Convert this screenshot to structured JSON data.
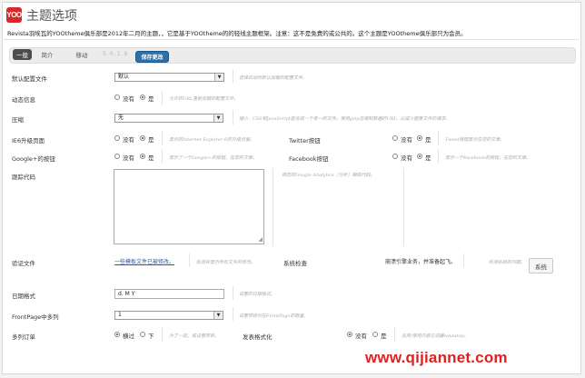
{
  "header": {
    "logo_text": "YOO",
    "title": "主题选项",
    "intro": "Revista羽埃瓦的YOOtheme俱乐部是2012年二月的主题，，它是基于YOOtheme的的轻线主题框架。注意：这不是免费的或公共的。这个主题是YOOtheme俱乐部只为会员。"
  },
  "tabs": [
    {
      "label": "一般",
      "active": true
    },
    {
      "label": "简介",
      "active": false
    },
    {
      "label": "移动",
      "active": false
    }
  ],
  "version": "5.0.1.8",
  "save_label": "保存更改",
  "fields": {
    "default_config": {
      "label": "默认配置文件",
      "value": "默认",
      "desc": "选择启动时默认加载的配置文件。"
    },
    "dynamic": {
      "label": "动态信息",
      "opt_no": "没有",
      "opt_yes": "是",
      "selected": "yes",
      "desc": "允许的URL重新加载的配置文件。"
    },
    "compress": {
      "label": "压缩",
      "value": "无",
      "desc": "缩小、CSS和JavaScript能合成一个单一的文件。使用gzip压缩和数据的URI，以减少图像文件的请求。"
    },
    "ie6": {
      "label": "IE6升级页面",
      "opt_no": "没有",
      "opt_yes": "是",
      "selected": "yes",
      "desc": "显示的Internet Explorer 6的升级页面。"
    },
    "twitter": {
      "label": "Twitter按钮",
      "opt_no": "没有",
      "opt_yes": "是",
      "selected": "yes",
      "desc": "Tweet按钮显示在您的文章。"
    },
    "google": {
      "label": "Google+的按钮",
      "opt_no": "没有",
      "opt_yes": "是",
      "selected": "yes",
      "desc": "显示了一个Google+的按钮，在您的文章。"
    },
    "facebook": {
      "label": "Facebook按钮",
      "opt_no": "没有",
      "opt_yes": "是",
      "selected": "yes",
      "desc": "显示一个Facebook的按钮，在您的文章。"
    },
    "tracking": {
      "label": "跟踪代码",
      "value": "",
      "desc": "将您的Google Analytics（分析）跟踪代码。"
    },
    "verify": {
      "label": "验证文件",
      "link": "一些模板文件已被修改。",
      "desc": "检测并显示所有文件的修改。"
    },
    "system_check": {
      "label": "系统检查",
      "status": "崩溃引擎业务，并准备起飞。",
      "desc": "检测系统的问题。",
      "button": "系统"
    },
    "date_format": {
      "label": "日期格式",
      "value": "d. M Y",
      "desc": "设置的日期格式。"
    },
    "frontpage_items": {
      "label": "FrontPage中多列",
      "value": "1",
      "desc": "设置项目列在FrontPage的数量。"
    },
    "multi_order": {
      "label": "多列订单",
      "opt_a": "横过",
      "opt_b": "下",
      "selected": "a",
      "desc": "为了一起，或设置项目。"
    },
    "pub_format": {
      "label": "发表格式化",
      "opt_no": "没有",
      "opt_yes": "是",
      "selected": "no",
      "desc": "应用/使用内容过滤器wpautop。"
    }
  },
  "watermark": "www.qijiannet.com"
}
